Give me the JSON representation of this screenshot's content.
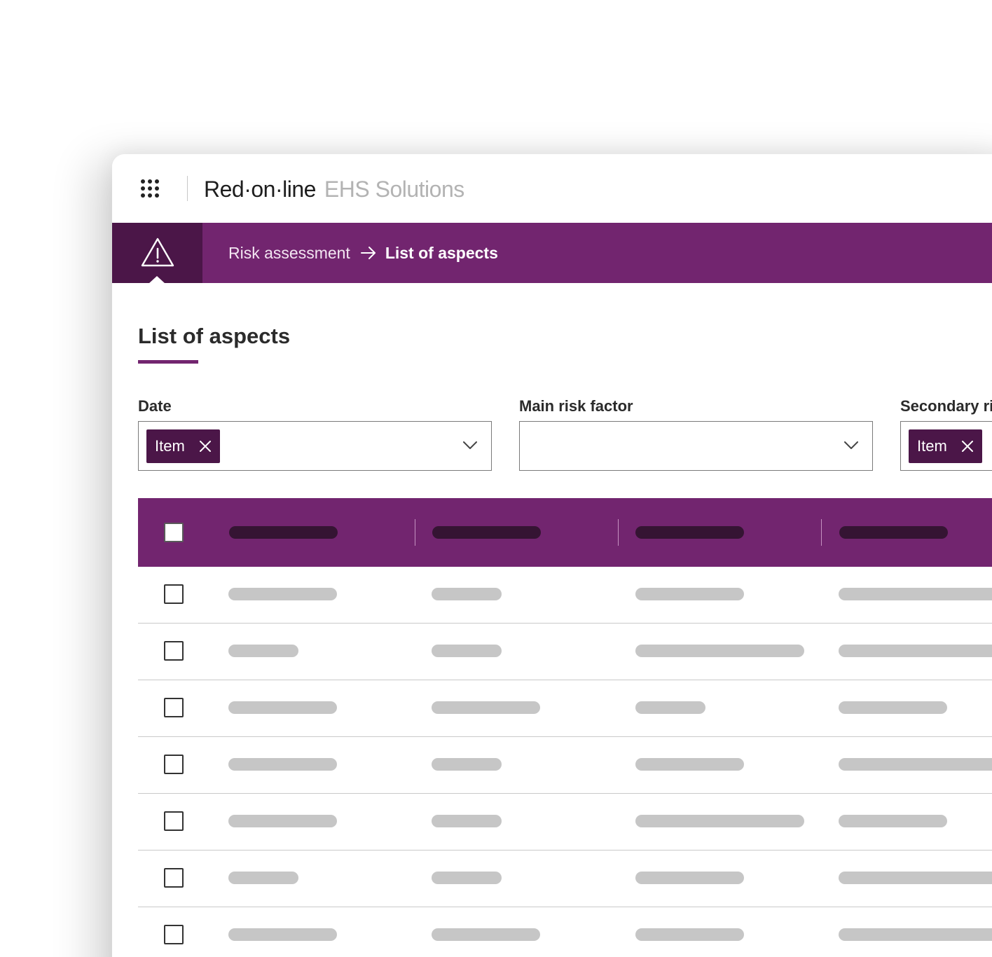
{
  "app": {
    "brand_name": "Red·on·line",
    "brand_sub": "EHS Solutions",
    "menu_icon": "apps-grid-icon"
  },
  "module": {
    "icon": "warning-triangle-icon"
  },
  "breadcrumb": {
    "parent": "Risk assessment",
    "separator_icon": "arrow-right-icon",
    "current": "List of aspects"
  },
  "page": {
    "title": "List of aspects"
  },
  "filters": {
    "date": {
      "label": "Date",
      "chip": "Item"
    },
    "main_risk": {
      "label": "Main risk factor"
    },
    "secondary_risk": {
      "label": "Secondary ri",
      "chip": "Item"
    }
  },
  "colors": {
    "accent": "#72256f",
    "accent_dark": "#4b1648",
    "placeholder_header": "#351433",
    "placeholder_row": "#c6c6c6"
  },
  "table": {
    "rows": 7,
    "columns": 4
  }
}
